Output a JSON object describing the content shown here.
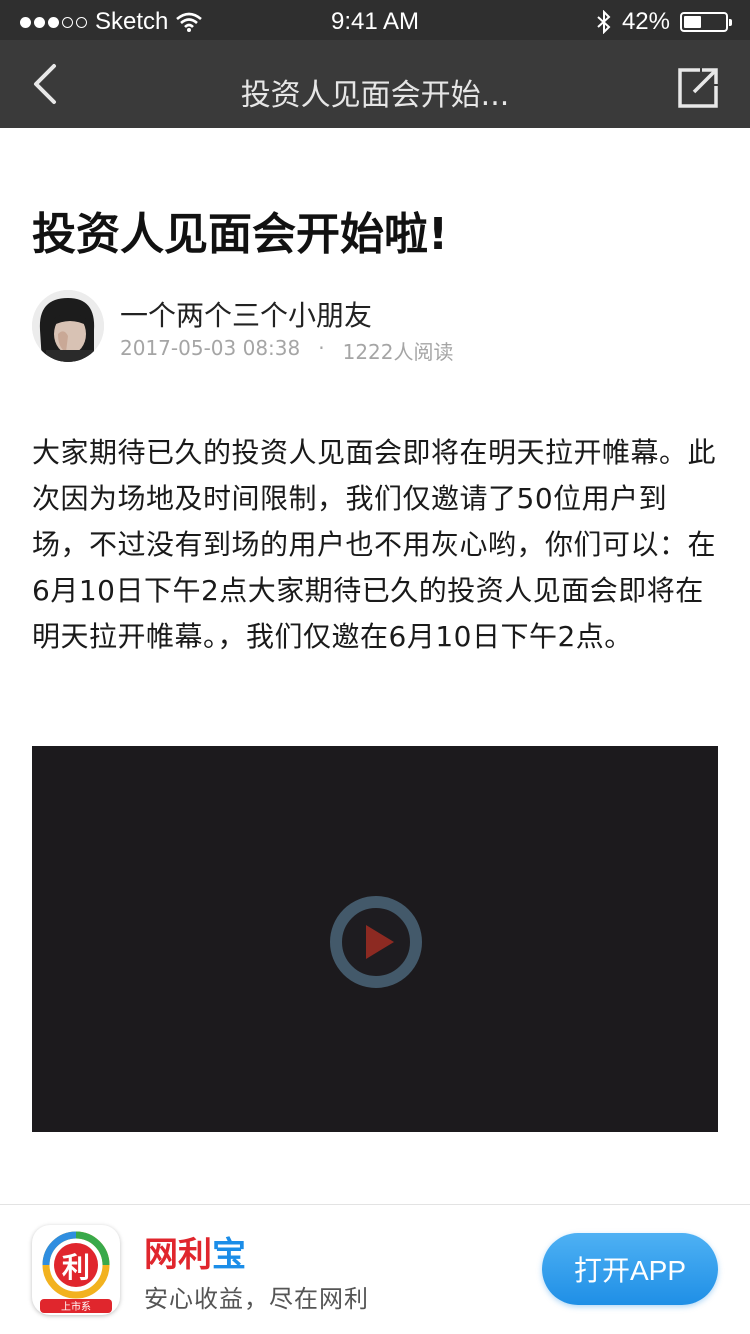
{
  "status_bar": {
    "carrier": "Sketch",
    "time": "9:41 AM",
    "battery_text": "42%",
    "battery_level": 0.42
  },
  "nav": {
    "title": "投资人见面会开始...",
    "back_icon": "chevron-left-icon",
    "share_icon": "share-external-icon"
  },
  "article": {
    "title": "投资人见面会开始啦!",
    "author": {
      "name": "一个两个三个小朋友",
      "date": "2017-05-03 08:38",
      "separator": "·",
      "reads": "1222人阅读"
    },
    "body": "大家期待已久的投资人见面会即将在明天拉开帷幕。此次因为场地及时间限制，我们仅邀请了50位用户到场，不过没有到场的用户也不用灰心哟，你们可以：在6月10日下午2点大家期待已久的投资人见面会即将在明天拉开帷幕。，我们仅邀在6月10日下午2点。",
    "video": {
      "play_icon": "play-icon"
    }
  },
  "banner": {
    "icon_glyph": "利",
    "icon_tag": "上市系",
    "brand_part1": "网利",
    "brand_part2": "宝",
    "slogan": "安心收益，尽在网利",
    "open_button": "打开APP"
  },
  "colors": {
    "nav_bg": "#3a3a3a",
    "status_bg": "#2f2f2f",
    "brand_red": "#e0262d",
    "brand_blue": "#1b8de8",
    "button_blue": "#2b98ea"
  }
}
